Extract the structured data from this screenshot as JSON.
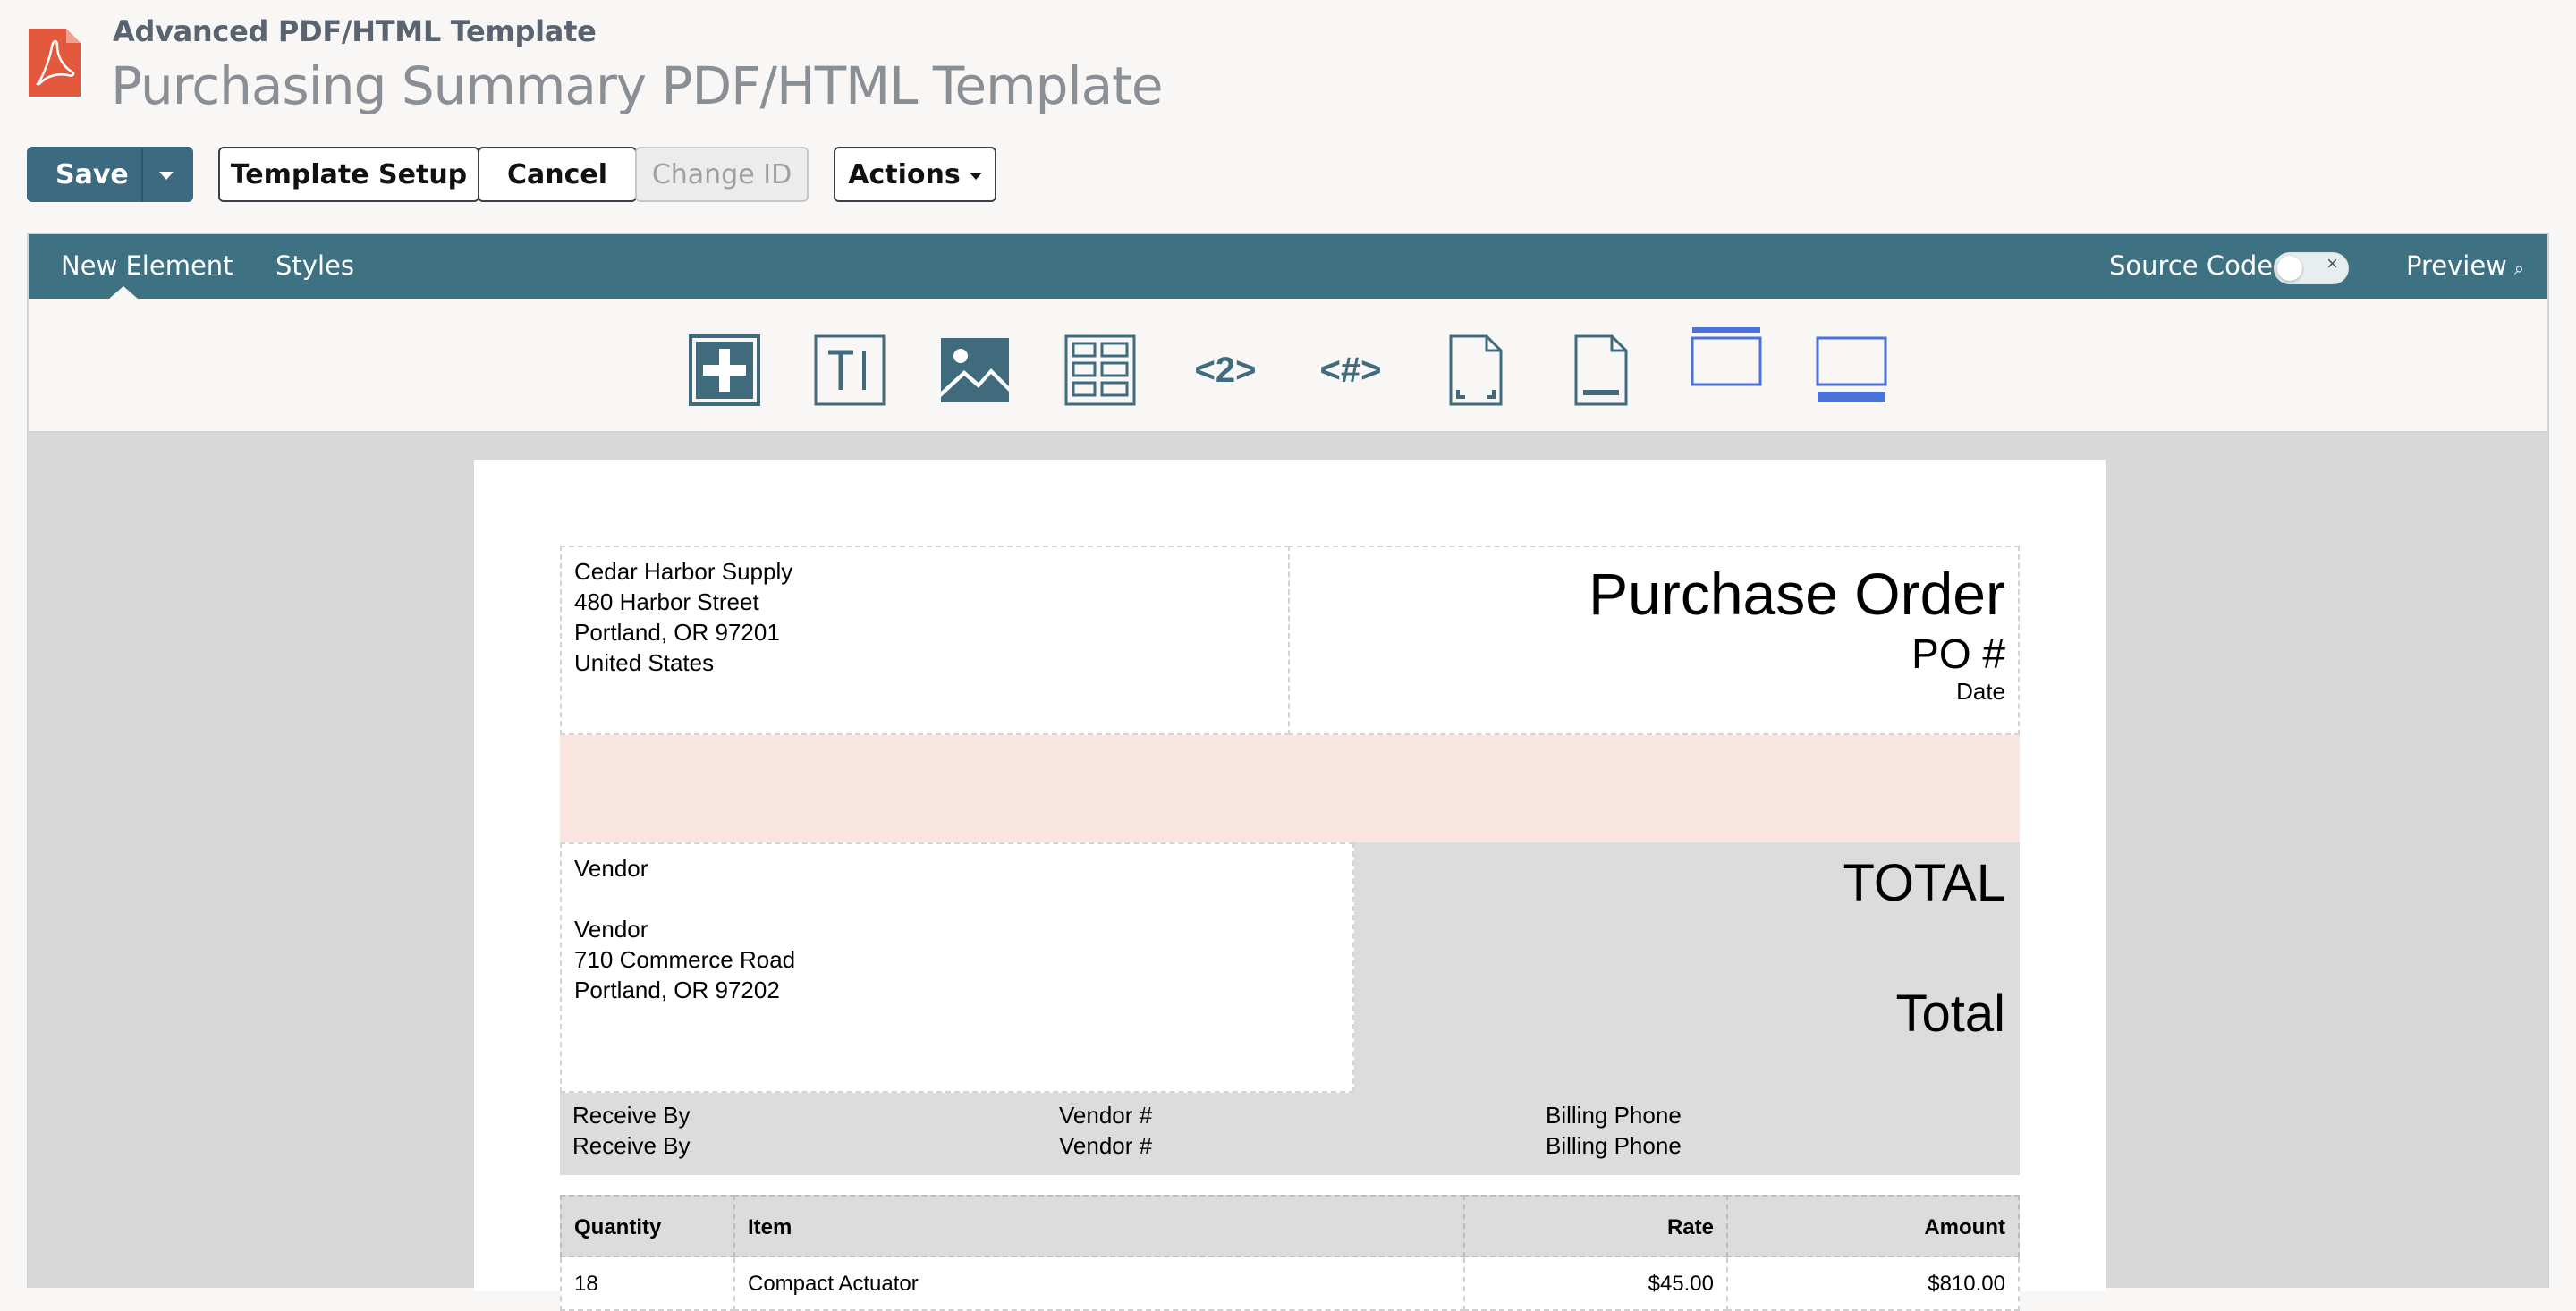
{
  "header": {
    "subtitle": "Advanced PDF/HTML Template",
    "title": "Purchasing Summary PDF/HTML Template"
  },
  "toolbar": {
    "save": "Save",
    "template_setup": "Template Setup",
    "cancel": "Cancel",
    "change_id": "Change ID",
    "actions": "Actions"
  },
  "editor": {
    "tabs": [
      "New Element",
      "Styles"
    ],
    "active_tab": "New Element",
    "source_code_label": "Source Code",
    "source_code_enabled": false,
    "preview_label": "Preview",
    "element_icons": [
      "add-element-icon",
      "text-icon",
      "image-icon",
      "table-icon",
      "field-icon",
      "page-number-icon",
      "page-body-icon",
      "page-footer-icon",
      "header-icon",
      "footer-icon"
    ],
    "field_icon_text": "<2>",
    "page_number_icon_text": "<#>"
  },
  "document": {
    "company": [
      "Cedar Harbor Supply",
      "480 Harbor Street",
      "Portland, OR 97201",
      "United States"
    ],
    "po_title": "Purchase Order",
    "po_number": "PO #",
    "po_date": "Date",
    "vendor_heading": "Vendor",
    "vendor_lines": [
      "Vendor",
      "710 Commerce Road",
      "Portland, OR 97202"
    ],
    "total_label": "TOTAL",
    "total_value": "Total",
    "info_labels": [
      "Receive By",
      "Vendor #",
      "Billing Phone"
    ],
    "info_values": [
      "Receive By",
      "Vendor #",
      "Billing Phone"
    ],
    "table_headers": [
      "Quantity",
      "Item",
      "Rate",
      "Amount"
    ],
    "table_rows": [
      [
        "18",
        "Compact Actuator",
        "$45.00",
        "$810.00"
      ]
    ]
  },
  "colors": {
    "primary": "#3b6a81",
    "editor_bar": "#3e7283",
    "pdf_logo": "#e4583e",
    "pink_band": "#f8e5df",
    "icon_blue": "#3f6b7d",
    "icon_accent": "#4a72d8"
  }
}
